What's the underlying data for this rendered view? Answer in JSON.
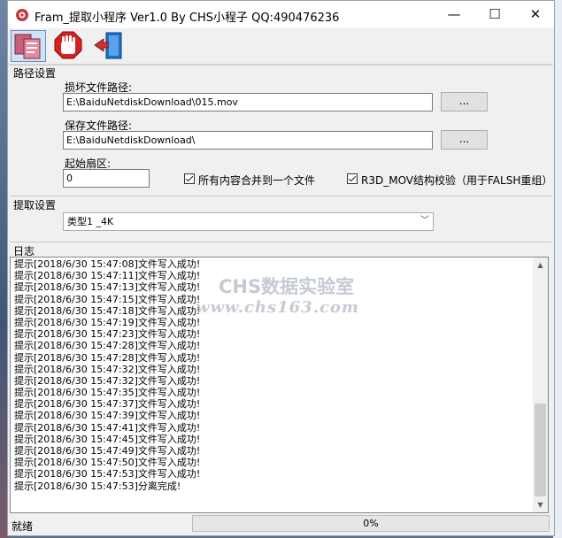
{
  "window": {
    "title": "Fram_提取小程序 Ver1.0  By CHS小程子 QQ:490476236",
    "minimize_glyph": "—",
    "maximize_glyph": "☐",
    "close_glyph": "✕"
  },
  "toolbar": {
    "buttons": [
      {
        "icon": "extract-icon",
        "active": true
      },
      {
        "icon": "stop-icon",
        "active": false
      },
      {
        "icon": "exit-door-icon",
        "active": false
      }
    ]
  },
  "path_settings": {
    "group_label": "路径设置",
    "damaged_label": "损坏文件路径:",
    "damaged_value": "E:\\BaiduNetdiskDownload\\015.mov",
    "save_label": "保存文件路径:",
    "save_value": "E:\\BaiduNetdiskDownload\\",
    "browse_label": "...",
    "start_sector_label": "起始扇区:",
    "start_sector_value": "0",
    "merge_checkbox_label": "所有内容合并到一个文件",
    "merge_checked": true,
    "r3d_checkbox_label": "R3D_MOV结构校验（用于FALSH重组）",
    "r3d_checked": true
  },
  "extract_settings": {
    "group_label": "提取设置",
    "type_value": "类型1        _4K"
  },
  "log": {
    "group_label": "日志",
    "lines": [
      "提示[2018/6/30 15:47:08]文件写入成功!",
      "提示[2018/6/30 15:47:11]文件写入成功!",
      "提示[2018/6/30 15:47:13]文件写入成功!",
      "提示[2018/6/30 15:47:15]文件写入成功!",
      "提示[2018/6/30 15:47:18]文件写入成功!",
      "提示[2018/6/30 15:47:19]文件写入成功!",
      "提示[2018/6/30 15:47:23]文件写入成功!",
      "提示[2018/6/30 15:47:28]文件写入成功!",
      "提示[2018/6/30 15:47:28]文件写入成功!",
      "提示[2018/6/30 15:47:32]文件写入成功!",
      "提示[2018/6/30 15:47:32]文件写入成功!",
      "提示[2018/6/30 15:47:35]文件写入成功!",
      "提示[2018/6/30 15:47:37]文件写入成功!",
      "提示[2018/6/30 15:47:39]文件写入成功!",
      "提示[2018/6/30 15:47:41]文件写入成功!",
      "提示[2018/6/30 15:47:45]文件写入成功!",
      "提示[2018/6/30 15:47:49]文件写入成功!",
      "提示[2018/6/30 15:47:50]文件写入成功!",
      "提示[2018/6/30 15:47:53]文件写入成功!",
      "提示[2018/6/30 15:47:53]分离完成!"
    ]
  },
  "watermark": {
    "line1": "CHS数据实验室",
    "line2": "www.chs163.com"
  },
  "status": {
    "text": "就绪",
    "progress_percent": 0,
    "progress_label": "0%"
  },
  "colors": {
    "progress_fill": "#06b025",
    "stop_red": "#d52121",
    "accent_blue": "#cfe3f8"
  }
}
